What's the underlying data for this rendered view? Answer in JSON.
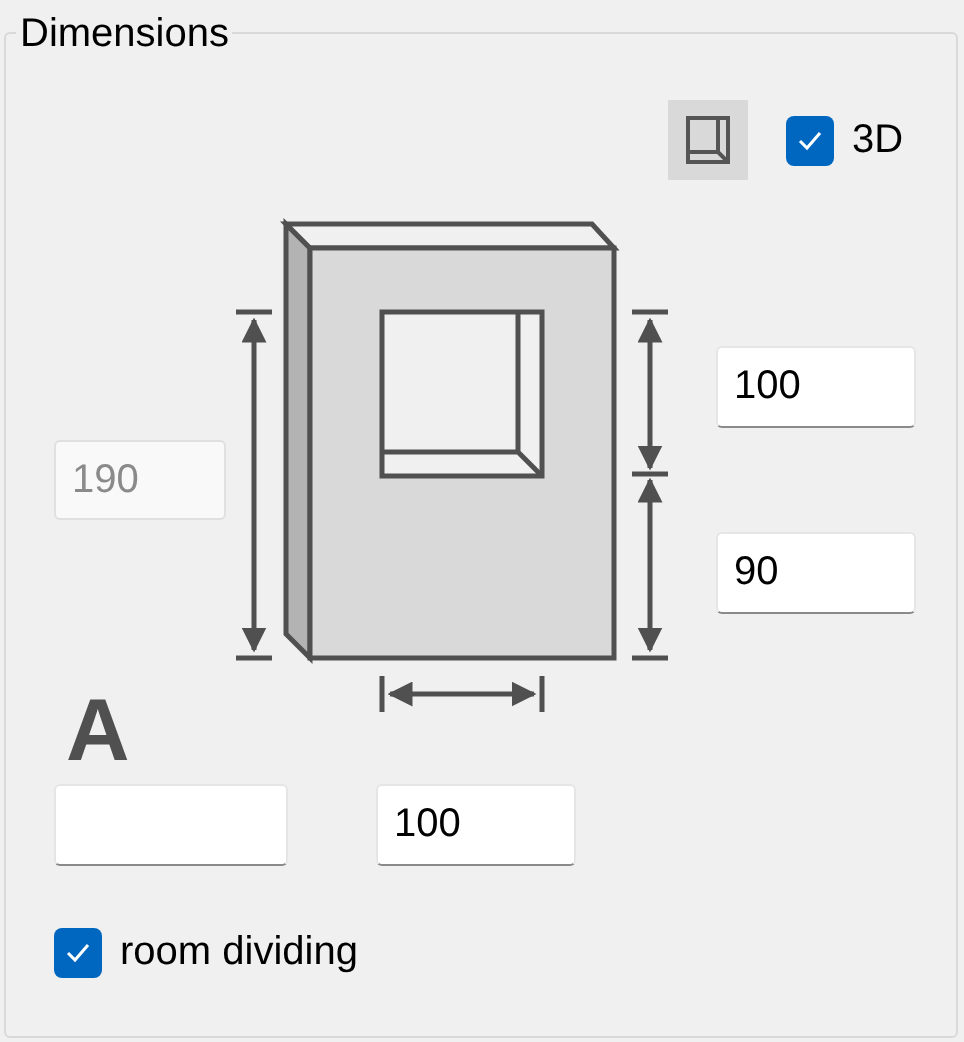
{
  "group": {
    "title": "Dimensions"
  },
  "view_button": {
    "selected": true
  },
  "three_d": {
    "label": "3D",
    "checked": true
  },
  "fields": [
    {
      "kind": "height",
      "value": "190",
      "disabled": true
    },
    {
      "kind": "upper",
      "value": "100",
      "disabled": false
    },
    {
      "kind": "lower",
      "value": "90",
      "disabled": false
    },
    {
      "kind": "width",
      "value": "100",
      "disabled": false
    },
    {
      "kind": "name",
      "disabled": false
    }
  ],
  "name_label": "A",
  "room_dividing": {
    "label": "room dividing",
    "checked": true
  }
}
